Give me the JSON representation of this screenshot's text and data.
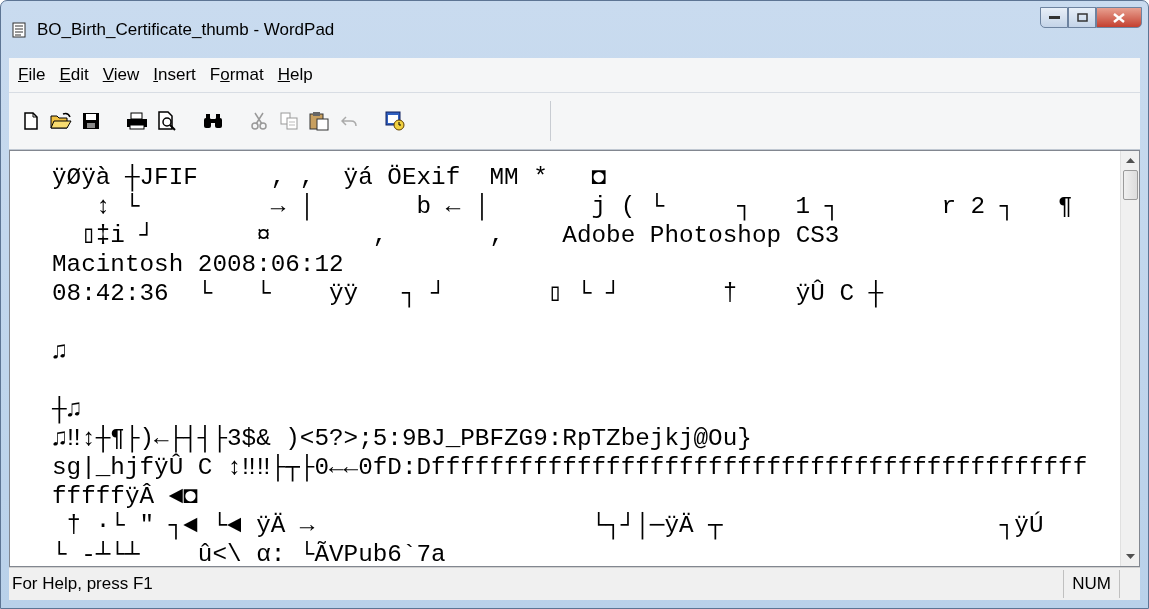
{
  "window": {
    "title": "BO_Birth_Certificate_thumb - WordPad"
  },
  "menu": [
    {
      "key": "F",
      "after": "ile"
    },
    {
      "key": "E",
      "after": "dit"
    },
    {
      "key": "V",
      "after": "iew"
    },
    {
      "key": "I",
      "after": "nsert"
    },
    {
      "before": "F",
      "key": "o",
      "after": "rmat"
    },
    {
      "key": "H",
      "after": "elp"
    }
  ],
  "toolbar": [
    {
      "kind": "new"
    },
    {
      "kind": "open"
    },
    {
      "kind": "save"
    },
    {
      "kind": "sep"
    },
    {
      "kind": "print"
    },
    {
      "kind": "preview"
    },
    {
      "kind": "sep"
    },
    {
      "kind": "find"
    },
    {
      "kind": "sep"
    },
    {
      "kind": "cut"
    },
    {
      "kind": "copy"
    },
    {
      "kind": "paste"
    },
    {
      "kind": "undo"
    },
    {
      "kind": "sep"
    },
    {
      "kind": "datetime"
    }
  ],
  "document": {
    "lines": [
      "ÿØÿà ┼JFIF     , ,  ÿá ÖExif  MM *   ◘",
      "   ↕ └         → │       b ← │       j ( └     ┐   1 ┐       r 2 ┐   ¶",
      "  ▯‡i ┘       ¤       ,       ,    Adobe Photoshop CS3",
      "Macintosh 2008:06:12",
      "08:42:36  └   └    ÿÿ   ┐ ┘       ▯ └ ┘       †    ÿÛ C ┼",
      {
        "text": "♫",
        "blank_line_before": true
      },
      {
        "text": "┼♫",
        "blank_line_before": true
      },
      "♫‼↕┼¶├)←├┤┤├3$& )<5?>;5:9BJ_PBFZG9:RpTZbejkj@Ou}",
      "sg|_hjfÿÛ C ↕‼‼├┬├0←←0fD:Dfffffffffffffffffffffffffffffffffffffffffffff",
      "fffffÿÂ ◄◘",
      " † ·└ \" ┐◄ └◄ ÿÄ →                   └┐┘│─ÿÄ ┬                   ┐ÿÚ",
      "└ -┴└┴    û<\\ α: └ÃVPub6`7a"
    ]
  },
  "status_bar": {
    "text": "For Help, press F1",
    "indicator": "NUM"
  }
}
